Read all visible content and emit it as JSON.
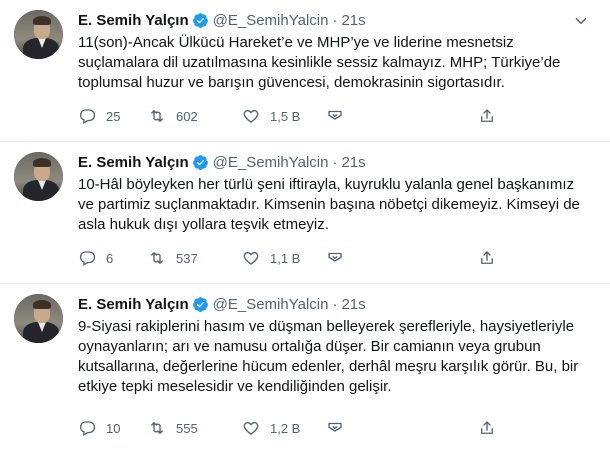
{
  "account": {
    "name": "E. Semih Yalçın",
    "handle": "@E_SemihYalcin",
    "separator": "·"
  },
  "icons": {
    "verified": "verified-badge-icon",
    "more": "chevron-down-icon",
    "reply": "reply-icon",
    "retweet": "retweet-icon",
    "like": "heart-icon",
    "share": "share-icon",
    "box": "upload-icon"
  },
  "colors": {
    "verified": "#1d9bf0",
    "muted": "#536471",
    "divider": "#e6ecf0"
  },
  "tweets": [
    {
      "time": "21s",
      "text": "11(son)-Ancak Ülkücü Hareket’e ve MHP’ye ve liderine mesnetsiz suçlamalara dil uzatılmasına kesinlikle sessiz kalmayız. MHP; Türkiye’de toplumsal huzur ve barışın güvencesi, demokrasinin sigortasıdır.",
      "replies": "25",
      "retweets": "602",
      "likes": "1,5 B"
    },
    {
      "time": "21s",
      "text": "10-Hâl böyleyken her türlü şeni iftirayla, kuyruklu yalanla genel başkanımız ve partimiz suçlanmaktadır. Kimsenin başına nöbetçi dikemeyiz. Kimseyi de asla hukuk dışı yollara teşvik etmeyiz.",
      "replies": "6",
      "retweets": "537",
      "likes": "1,1 B"
    },
    {
      "time": "21s",
      "text": "9-Siyasi rakiplerini hasım ve düşman belleyerek şerefleriyle, haysiyetleriyle oynayanların; arı ve namusu ortalığa düşer. Bir camianın veya grubun kutsallarına, değerlerine hücum edenler, derhâl meşru karşılık görür. Bu, bir etkiye tepki meselesidir ve kendiliğinden gelişir.",
      "replies": "10",
      "retweets": "555",
      "likes": "1,2 B"
    }
  ]
}
